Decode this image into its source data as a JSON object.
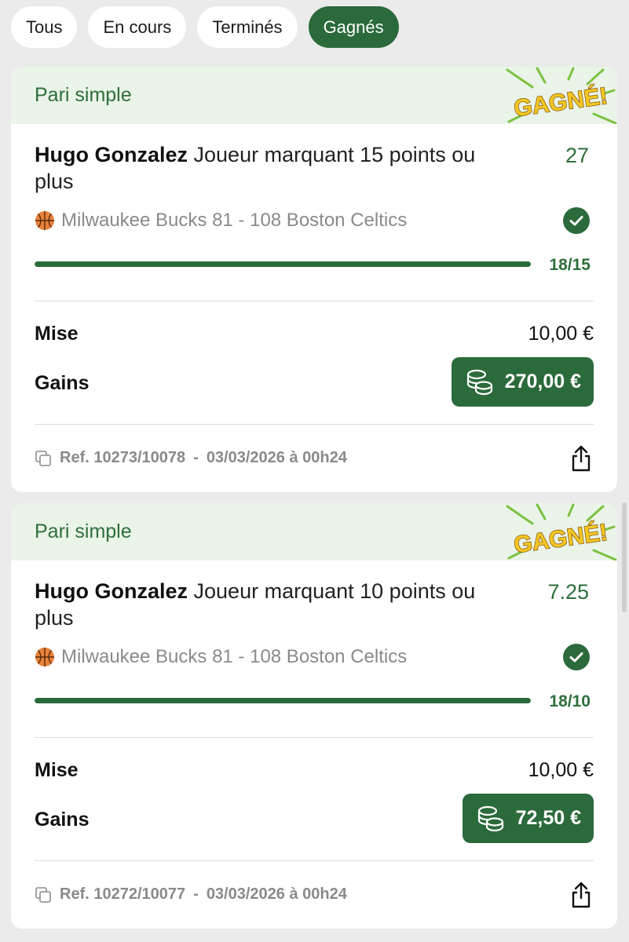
{
  "filters": {
    "tabs": [
      "Tous",
      "En cours",
      "Terminés",
      "Gagnés"
    ],
    "active": "Gagnés"
  },
  "colors": {
    "brand_green": "#2b6a3b",
    "header_bg": "#eaf4e8",
    "badge_yellow": "#f3c623"
  },
  "bets": [
    {
      "type": "Pari simple",
      "badge": "GAGNÉ!",
      "player": "Hugo Gonzalez",
      "market": "Joueur marquant 15 points ou plus",
      "odds": "27",
      "event": "Milwaukee Bucks 81 - 108 Boston Celtics",
      "event_icon": "basketball-icon",
      "progress": {
        "current": 18,
        "target": 15,
        "fraction": 1.0,
        "label": "18/15"
      },
      "stake_label": "Mise",
      "stake": "10,00 €",
      "gains_label": "Gains",
      "gains": "270,00 €",
      "ref": "Ref. 10273/10078",
      "date": "03/03/2026 à 00h24"
    },
    {
      "type": "Pari simple",
      "badge": "GAGNÉ!",
      "player": "Hugo Gonzalez",
      "market": "Joueur marquant 10 points ou plus",
      "odds": "7.25",
      "event": "Milwaukee Bucks 81 - 108 Boston Celtics",
      "event_icon": "basketball-icon",
      "progress": {
        "current": 18,
        "target": 10,
        "fraction": 1.0,
        "label": "18/10"
      },
      "stake_label": "Mise",
      "stake": "10,00 €",
      "gains_label": "Gains",
      "gains": "72,50 €",
      "ref": "Ref. 10272/10077",
      "date": "03/03/2026 à 00h24"
    }
  ]
}
